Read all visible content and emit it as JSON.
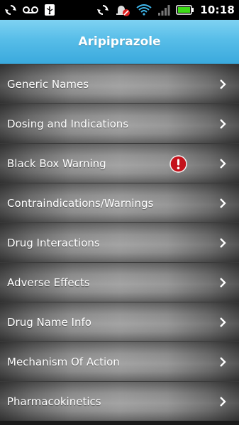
{
  "status_bar": {
    "time": "10:18",
    "icons": [
      "sync-icon",
      "voicemail-icon",
      "usb-icon",
      "sync-icon",
      "alarm-off-icon",
      "wifi-icon",
      "signal-icon",
      "battery-icon"
    ],
    "colors": {
      "battery_fill": "#3ddc17",
      "wifi": "#3fb6ea",
      "alarm_badge": "#e02020"
    }
  },
  "header": {
    "title": "Aripiprazole",
    "background_color": "#57bde8"
  },
  "menu": {
    "items": [
      {
        "label": "Generic Names"
      },
      {
        "label": "Dosing and Indications"
      },
      {
        "label": "Black Box Warning",
        "badge": "alert-icon"
      },
      {
        "label": "Contraindications/Warnings"
      },
      {
        "label": "Drug Interactions"
      },
      {
        "label": "Adverse Effects"
      },
      {
        "label": "Drug Name Info"
      },
      {
        "label": "Mechanism Of Action"
      },
      {
        "label": "Pharmacokinetics"
      }
    ],
    "alert_color": "#c4121b"
  }
}
